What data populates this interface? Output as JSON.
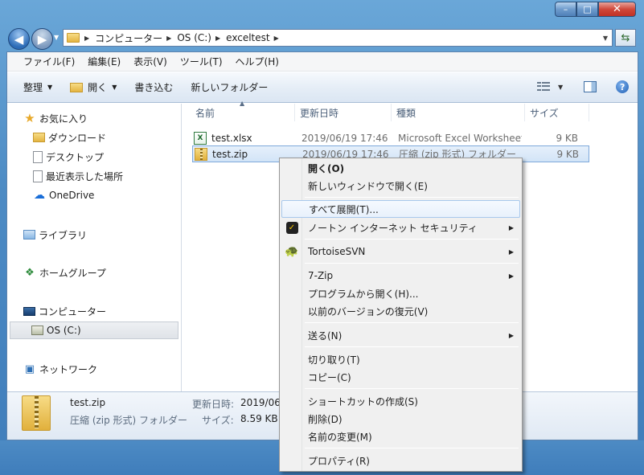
{
  "window": {
    "controls": {
      "min": "–",
      "max": "□",
      "close": "✕"
    }
  },
  "address": {
    "crumbs": [
      "コンピューター",
      "OS (C:)",
      "exceltest"
    ],
    "refresh_icon": "refresh-icon"
  },
  "menubar": {
    "items": [
      "ファイル(F)",
      "編集(E)",
      "表示(V)",
      "ツール(T)",
      "ヘルプ(H)"
    ]
  },
  "toolbar": {
    "organize": "整理",
    "open": "開く",
    "burn": "書き込む",
    "new_folder": "新しいフォルダー",
    "help": "?"
  },
  "nav": {
    "favorites": "お気に入り",
    "downloads": "ダウンロード",
    "desktop": "デスクトップ",
    "recent": "最近表示した場所",
    "onedrive": "OneDrive",
    "libraries": "ライブラリ",
    "homegroup": "ホームグループ",
    "computer": "コンピューター",
    "drive_c": "OS (C:)",
    "network": "ネットワーク"
  },
  "columns": [
    "名前",
    "更新日時",
    "種類",
    "サイズ"
  ],
  "files": [
    {
      "name": "test.xlsx",
      "date": "2019/06/19 17:46",
      "type": "Microsoft Excel Worksheet",
      "size": "9 KB",
      "icon": "xlsx-icon"
    },
    {
      "name": "test.zip",
      "date": "2019/06/19 17:46",
      "type": "圧縮 (zip 形式) フォルダー",
      "size": "9 KB",
      "icon": "zip-icon"
    }
  ],
  "details": {
    "name": "test.zip",
    "type": "圧縮 (zip 形式) フォルダー",
    "date_label": "更新日時:",
    "date_value": "2019/06/",
    "size_label": "サイズ:",
    "size_value": "8.59 KB"
  },
  "context_menu": {
    "open": "開く(O)",
    "open_new_window": "新しいウィンドウで開く(E)",
    "extract_all": "すべて展開(T)...",
    "norton": "ノートン インターネット セキュリティ",
    "tortoise": "TortoiseSVN",
    "sevenzip": "7-Zip",
    "open_with": "プログラムから開く(H)...",
    "restore": "以前のバージョンの復元(V)",
    "send_to": "送る(N)",
    "cut": "切り取り(T)",
    "copy": "コピー(C)",
    "shortcut": "ショートカットの作成(S)",
    "delete": "削除(D)",
    "rename": "名前の変更(M)",
    "properties": "プロパティ(R)"
  },
  "colors": {
    "frame": "#4d8bc4",
    "selection": "#d2e4f7",
    "menu_bg": "#f0f0f0"
  }
}
